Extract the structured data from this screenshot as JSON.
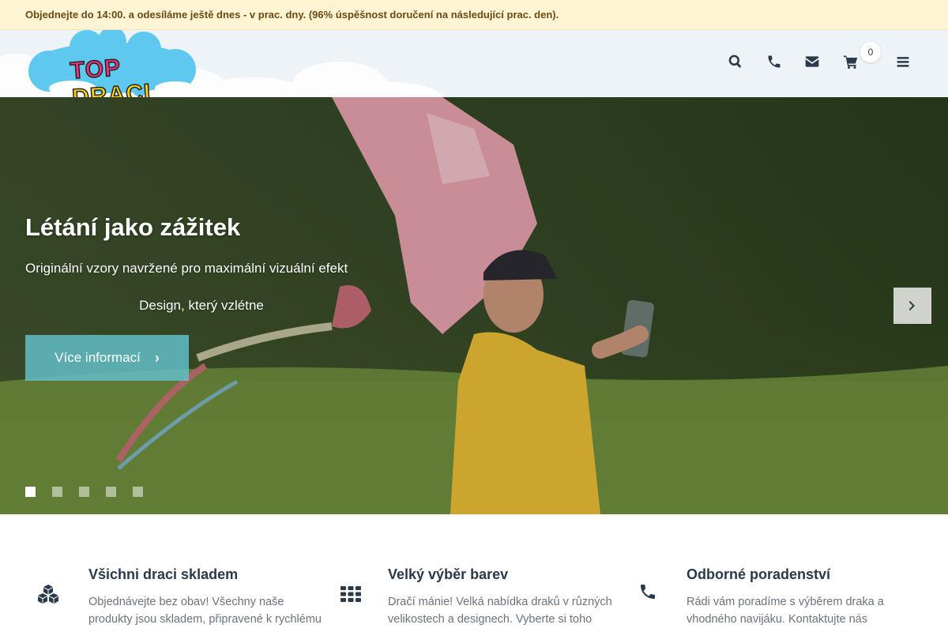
{
  "notice": {
    "text": "Objednejte do 14:00. a odesíláme ještě dnes - v prac. dny. (96% úspěšnost doručení na následující prac. den)."
  },
  "header": {
    "logo": {
      "word1": "TOP",
      "word2": "DRACI"
    },
    "icons": [
      "search-icon",
      "phone-icon",
      "envelope-icon",
      "cart-icon",
      "menu-icon"
    ],
    "cart_count": "0"
  },
  "hero": {
    "title": "Létání jako zážitek",
    "subtitle": "Originální vzory navržené pro maximální vizuální efekt",
    "tagline": "Design, který vzlétne",
    "button_label": "Více informací",
    "slides_total": 5,
    "active_slide": 1
  },
  "features": [
    {
      "icon": "cubes-icon",
      "title": "Všichni draci skladem",
      "text": "Objednávejte bez obav! Všechny naše produkty jsou skladem, připravené k rychlému"
    },
    {
      "icon": "grid-icon",
      "title": "Velký výběr barev",
      "text": "Dračí mánie! Velká nabídka draků v různých velikostech a designech. Vyberte si toho"
    },
    {
      "icon": "phone-icon",
      "title": "Odborné poradenství",
      "text": "Rádi vám poradíme s výběrem draka a vhodného navijáku. Kontaktujte nás"
    }
  ],
  "colors": {
    "notice_bg": "#fdf4d3",
    "notice_text": "#6b4a12",
    "header_bg": "#eef3f8",
    "button_bg": "#62bec8",
    "icon_dark": "#2a3a4a",
    "logo_pink": "#f0337d",
    "logo_yellow": "#ffd313"
  }
}
